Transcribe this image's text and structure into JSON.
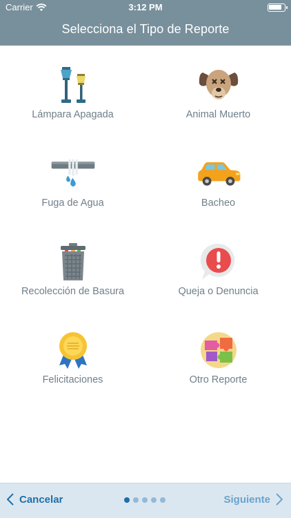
{
  "status_bar": {
    "carrier": "Carrier",
    "time": "3:12 PM",
    "battery_level": 0.85
  },
  "nav": {
    "title": "Selecciona el Tipo de Reporte"
  },
  "report_types": [
    {
      "label": "Lámpara Apagada",
      "icon": "street-lamp-icon"
    },
    {
      "label": "Animal Muerto",
      "icon": "dead-dog-icon"
    },
    {
      "label": "Fuga de Agua",
      "icon": "water-leak-pipe-icon"
    },
    {
      "label": "Bacheo",
      "icon": "car-pothole-icon"
    },
    {
      "label": "Recolección de Basura",
      "icon": "trash-can-icon"
    },
    {
      "label": "Queja o Denuncia",
      "icon": "alert-bubble-icon"
    },
    {
      "label": "Felicitaciones",
      "icon": "award-ribbon-icon"
    },
    {
      "label": "Otro Reporte",
      "icon": "puzzle-icon"
    }
  ],
  "bottom_bar": {
    "cancel_label": "Cancelar",
    "next_label": "Siguiente",
    "page_count": 5,
    "current_page": 1
  },
  "colors": {
    "header_bg": "#78909c",
    "bottom_bar_bg": "#dbe7f0",
    "accent": "#1f6fa8",
    "label_text": "#6f7f8a"
  }
}
